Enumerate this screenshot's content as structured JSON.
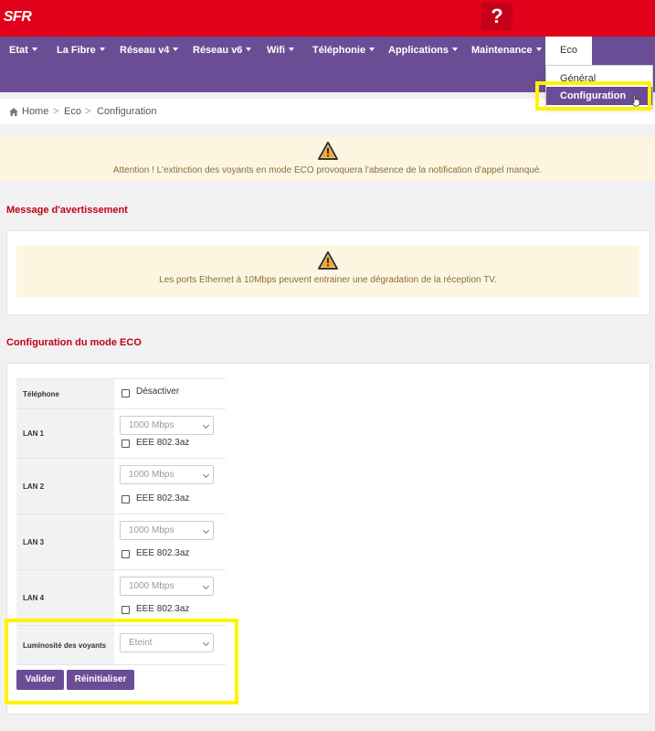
{
  "header": {
    "logo": "SFR",
    "help_label": "?"
  },
  "nav": {
    "items": [
      {
        "label": "Etat"
      },
      {
        "label": "La Fibre"
      },
      {
        "label": "Réseau v4"
      },
      {
        "label": "Réseau v6"
      },
      {
        "label": "Wifi"
      },
      {
        "label": "Téléphonie"
      },
      {
        "label": "Applications"
      },
      {
        "label": "Maintenance"
      }
    ],
    "active": "Eco",
    "dropdown": {
      "items": [
        "Général",
        "Configuration"
      ],
      "selected": "Configuration"
    }
  },
  "breadcrumb": {
    "home": "Home",
    "section": "Eco",
    "page": "Configuration"
  },
  "alert_top": "Attention ! L'extinction des voyants en mode ECO provoquera l'absence de la notification d'appel manqué.",
  "warning_section": {
    "title": "Message d'avertissement",
    "message": "Les ports Ethernet à 10Mbps peuvent entrainer une dégradation de la réception TV."
  },
  "eco_config": {
    "title": "Configuration du mode ECO",
    "telephone": {
      "label": "Téléphone",
      "checkbox_label": "Désactiver"
    },
    "lans": [
      {
        "label": "LAN 1",
        "speed": "1000 Mbps",
        "checkbox_label": "EEE 802.3az"
      },
      {
        "label": "LAN 2",
        "speed": "1000 Mbps",
        "checkbox_label": "EEE 802.3az"
      },
      {
        "label": "LAN 3",
        "speed": "1000 Mbps",
        "checkbox_label": "EEE 802.3az"
      },
      {
        "label": "LAN 4",
        "speed": "1000 Mbps",
        "checkbox_label": "EEE 802.3az"
      }
    ],
    "brightness": {
      "label": "Luminosité des voyants",
      "value": "Eteint"
    },
    "buttons": {
      "validate": "Valider",
      "reset": "Réinitialiser"
    }
  },
  "colors": {
    "brand_red": "#e2001a",
    "nav_purple": "#6b4d96",
    "highlight": "#fff200",
    "section_title": "#c00018"
  }
}
